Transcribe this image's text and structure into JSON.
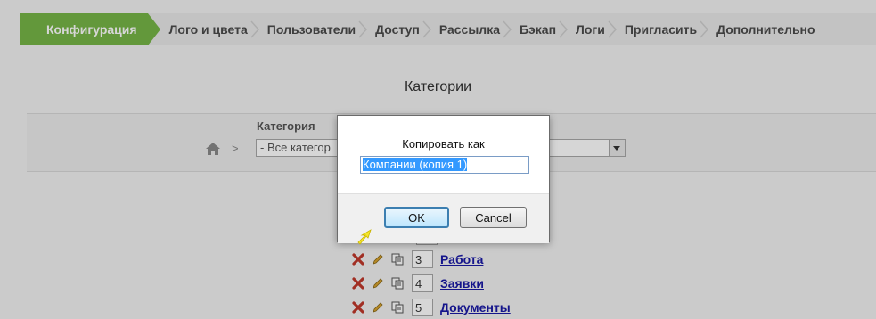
{
  "tabs": [
    {
      "label": "Конфигурация",
      "active": true
    },
    {
      "label": "Лого и цвета"
    },
    {
      "label": "Пользователи"
    },
    {
      "label": "Доступ"
    },
    {
      "label": "Рассылка"
    },
    {
      "label": "Бэкап"
    },
    {
      "label": "Логи"
    },
    {
      "label": "Пригласить"
    },
    {
      "label": "Дополнительно"
    }
  ],
  "page": {
    "heading": "Категории"
  },
  "filter": {
    "label": "Категория",
    "crumb_separator": ">",
    "select_value": "- Все категор"
  },
  "rows": [
    {
      "num": "3",
      "name": "Работа"
    },
    {
      "num": "4",
      "name": "Заявки"
    },
    {
      "num": "5",
      "name": "Документы"
    }
  ],
  "dialog": {
    "prompt": "Копировать как",
    "input_value": "Компании (копия 1)",
    "ok_label": "OK",
    "cancel_label": "Cancel"
  },
  "colors": {
    "accent": "#76b547",
    "link": "#1a1aa6",
    "delete": "#c0392b"
  },
  "icons": {
    "home": "home-icon",
    "delete": "delete-icon",
    "edit": "pencil-icon",
    "copy": "copy-icon",
    "cursor": "arrow-cursor-icon"
  }
}
